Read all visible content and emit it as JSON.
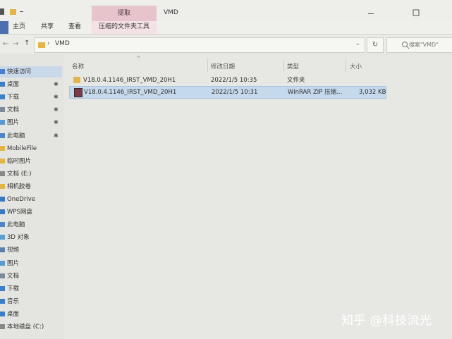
{
  "window": {
    "title": "VMD",
    "context_tab_header": "提取"
  },
  "ribbon": {
    "tabs": [
      "主页",
      "共享",
      "查看",
      "压缩的文件夹工具"
    ]
  },
  "address": {
    "path": "VMD",
    "search_placeholder": "搜索\"VMD\""
  },
  "sidebar": {
    "items": [
      {
        "label": "快速访问",
        "pinned": false,
        "icon": "star-icon",
        "selected": true
      },
      {
        "label": "桌面",
        "pinned": true,
        "icon": "desktop-icon"
      },
      {
        "label": "下载",
        "pinned": true,
        "icon": "download-icon"
      },
      {
        "label": "文档",
        "pinned": true,
        "icon": "document-icon"
      },
      {
        "label": "图片",
        "pinned": true,
        "icon": "picture-icon"
      },
      {
        "label": "此电脑",
        "pinned": true,
        "icon": "computer-icon"
      },
      {
        "label": "MobileFile",
        "pinned": false,
        "icon": "folder-icon"
      },
      {
        "label": "临时图片",
        "pinned": false,
        "icon": "folder-icon"
      },
      {
        "label": "文档 (E:)",
        "pinned": false,
        "icon": "drive-icon"
      },
      {
        "label": "相机胶卷",
        "pinned": false,
        "icon": "folder-icon"
      },
      {
        "label": "OneDrive",
        "pinned": false,
        "icon": "cloud-icon"
      },
      {
        "label": "WPS网盘",
        "pinned": false,
        "icon": "cloud-icon"
      },
      {
        "label": "此电脑",
        "pinned": false,
        "icon": "computer-icon"
      },
      {
        "label": "3D 对象",
        "pinned": false,
        "icon": "cube-icon"
      },
      {
        "label": "视频",
        "pinned": false,
        "icon": "video-icon"
      },
      {
        "label": "图片",
        "pinned": false,
        "icon": "picture-icon"
      },
      {
        "label": "文档",
        "pinned": false,
        "icon": "document-icon"
      },
      {
        "label": "下载",
        "pinned": false,
        "icon": "download-icon"
      },
      {
        "label": "音乐",
        "pinned": false,
        "icon": "music-icon"
      },
      {
        "label": "桌面",
        "pinned": false,
        "icon": "desktop-icon"
      },
      {
        "label": "本地磁盘 (C:)",
        "pinned": false,
        "icon": "drive-icon"
      }
    ]
  },
  "columns": {
    "name": "名称",
    "modified": "修改日期",
    "type": "类型",
    "size": "大小"
  },
  "files": [
    {
      "name": "V18.0.4.1146_IRST_VMD_20H1",
      "modified": "2022/1/5 10:35",
      "type": "文件夹",
      "size": "",
      "icon": "folder-icon",
      "selected": false
    },
    {
      "name": "V18.0.4.1146_IRST_VMD_20H1",
      "modified": "2022/1/5 10:31",
      "type": "WinRAR ZIP 压缩...",
      "size": "3,032 KB",
      "icon": "winrar-icon",
      "selected": true
    }
  ],
  "watermark": "知乎 @科技流光",
  "colors": {
    "selection": "#c5d9ec",
    "context_tab": "#e7c3cc",
    "folder": "#e2b44a"
  }
}
